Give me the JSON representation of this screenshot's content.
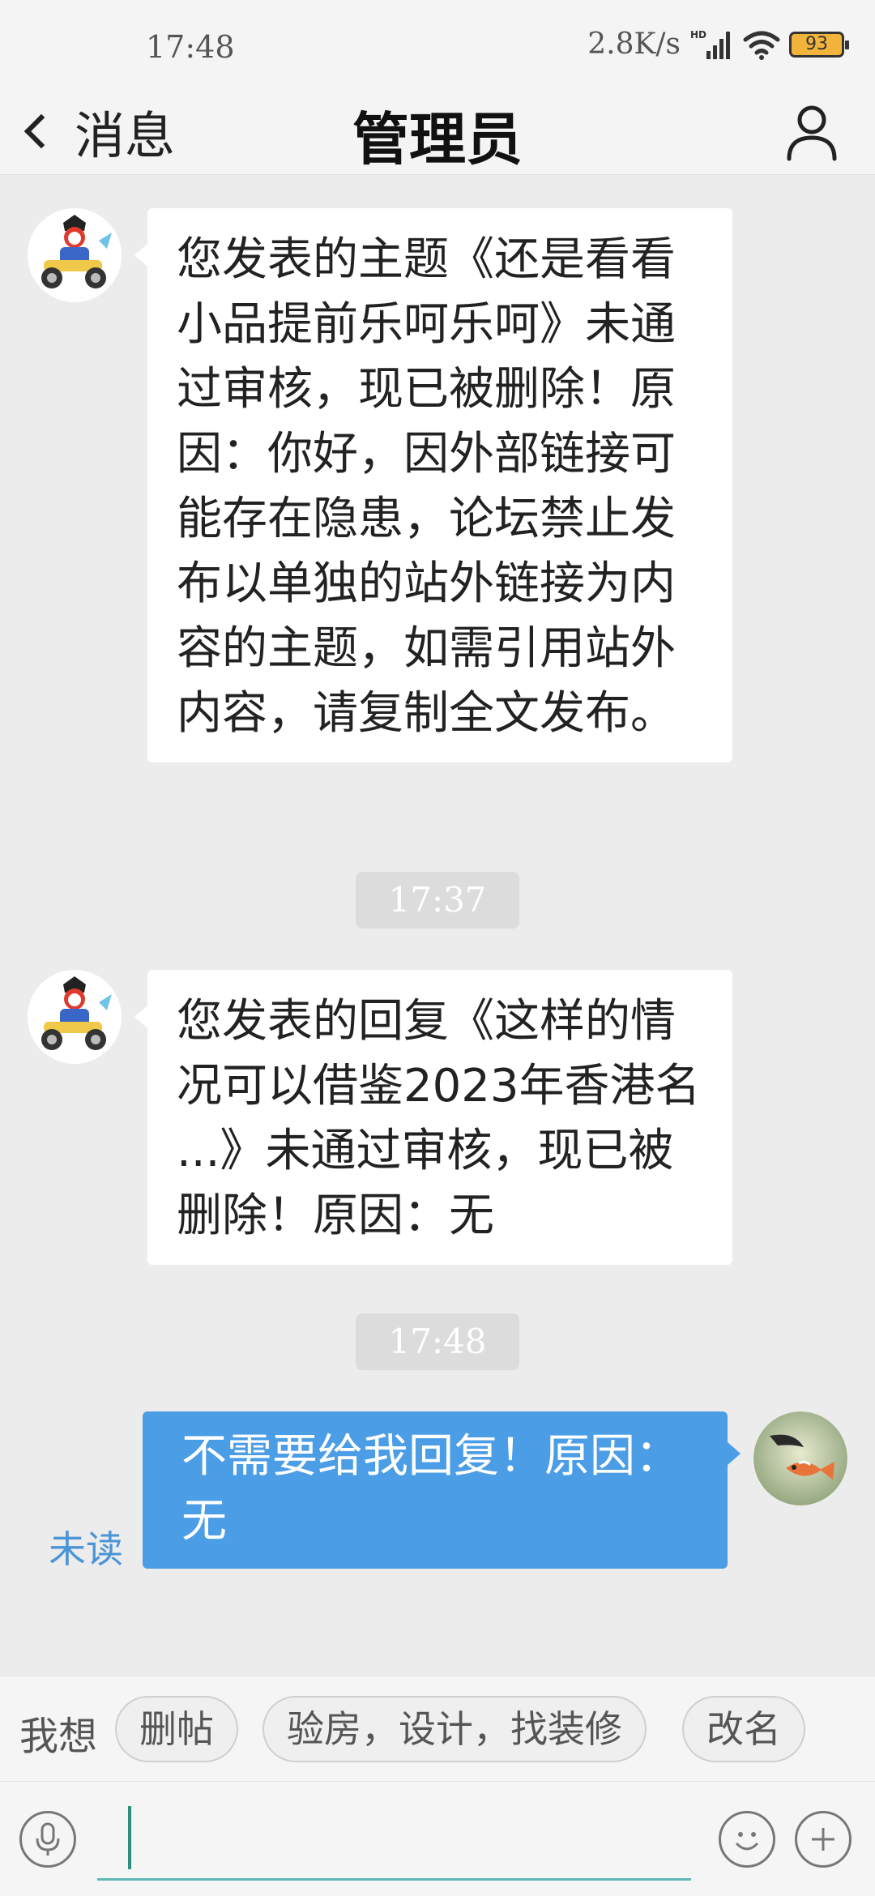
{
  "status_bar": {
    "time": "17:48",
    "net_speed": "2.8K/s",
    "battery_level": "93",
    "icons": [
      "hd-signal-icon",
      "wifi-icon",
      "battery-icon"
    ]
  },
  "header": {
    "back_label": "消息",
    "title": "管理员"
  },
  "messages": [
    {
      "direction": "incoming",
      "text": "您发表的主题《还是看看小品提前乐呵乐呵》未通过审核，现已被删除！原因：你好，因外部链接可能存在隐患，论坛禁止发布以单独的站外链接为内容的主题，如需引用站外内容，请复制全文发布。"
    },
    {
      "timestamp": "17:37"
    },
    {
      "direction": "incoming",
      "text": "您发表的回复《这样的情况可以借鉴2023年香港名 ...》未通过审核，现已被删除！原因：无"
    },
    {
      "timestamp": "17:48"
    },
    {
      "direction": "outgoing",
      "text": "不需要给我回复！原因：无",
      "status": "未读"
    }
  ],
  "quick_replies": {
    "label": "我想",
    "chips": [
      "删帖",
      "验房，设计，找装修",
      "改名"
    ]
  },
  "input": {
    "value": "",
    "placeholder": ""
  },
  "colors": {
    "outgoing_bubble": "#4b9de6",
    "unread_text": "#4a94d8",
    "input_underline": "#5fb8b6"
  }
}
